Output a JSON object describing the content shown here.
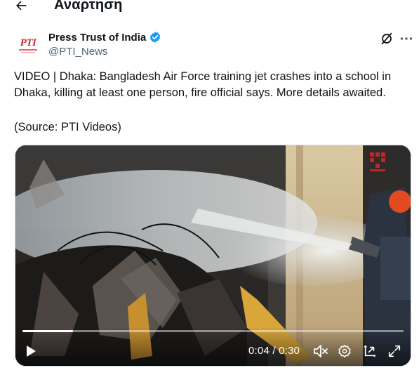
{
  "header": {
    "title": "Αναρτηση",
    "back_icon": "arrow-left-icon"
  },
  "author": {
    "avatar_text": "PTI",
    "name": "Press Trust of India",
    "handle": "@PTI_News",
    "verified_color": "#1d9bf0"
  },
  "tweet": {
    "text": "VIDEO | Dhaka: Bangladesh Air Force training jet crashes into a school in Dhaka, killing at least one person, fire official says. More details awaited.",
    "source": "(Source: PTI Videos)"
  },
  "video": {
    "current_time": "0:04",
    "duration": "0:30",
    "time_display": "0:04 / 0:30",
    "progress_fraction": 0.133,
    "icons": [
      "play-icon",
      "volume-muted-icon",
      "settings-gear-icon",
      "picture-in-picture-icon",
      "fullscreen-expand-icon"
    ]
  },
  "colors": {
    "text": "#0f1419",
    "secondary": "#536471",
    "accent": "#1d9bf0",
    "brand_red": "#d8262c"
  }
}
